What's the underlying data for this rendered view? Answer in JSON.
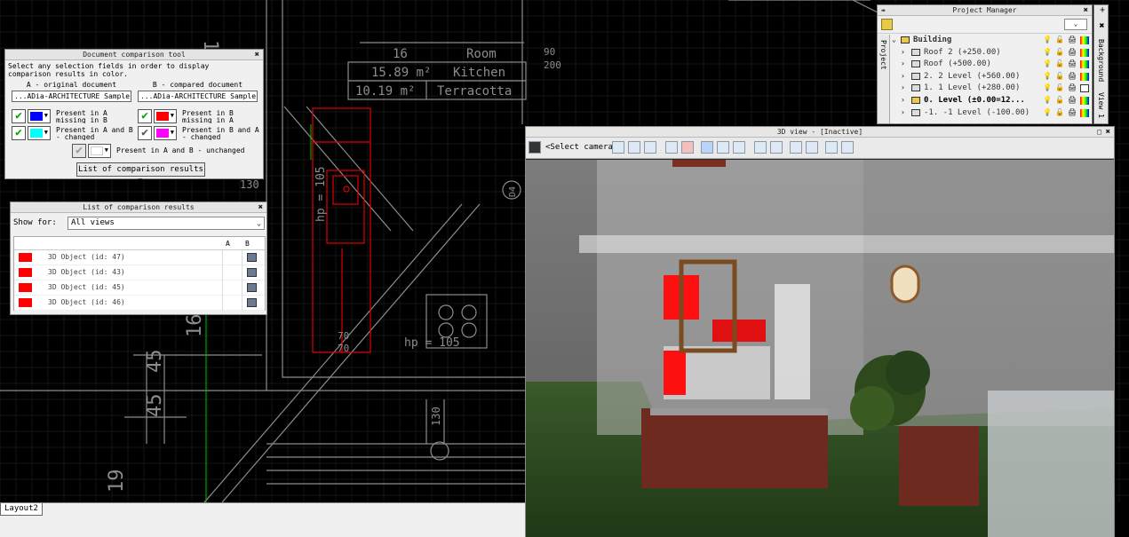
{
  "doc_tool": {
    "title": "Document comparison tool",
    "description": "Select any selection fields in order to display comparison results in color.",
    "col_a_header": "A - original document",
    "col_b_header": "B - compared document",
    "doc_a": "...ADia-ARCHITECTURE Sample 2",
    "doc_b": "...ADia-ARCHITECTURE Sample 2",
    "opt_a_missing": "Present in A missing in B",
    "opt_ab_changed": "Present in A and B - changed",
    "opt_b_missing": "Present in B missing in A",
    "opt_ba_changed": "Present in B and A - changed",
    "opt_unchanged": "Present in A and B - unchanged",
    "results_button": "List of comparison results",
    "colors": {
      "a_missing": "#0000ff",
      "ab_changed": "#00ffff",
      "b_missing": "#ff0000",
      "ba_changed": "#ff00ff",
      "unchanged": "#ffffff"
    }
  },
  "results": {
    "title": "List of comparison results",
    "show_for_label": "Show for:",
    "show_for_value": "All views",
    "col_a": "A",
    "col_b": "B",
    "rows": [
      "3D Object (id: 47)",
      "3D Object (id: 43)",
      "3D Object (id: 45)",
      "3D Object (id: 46)"
    ]
  },
  "project_manager": {
    "title": "Project Manager",
    "side_tab": "Project",
    "items": [
      "Building",
      "Roof 2 (+250.00)",
      "Roof (+500.00)",
      "2. 2 Level (+560.00)",
      "1. 1 Level (+280.00)",
      "0. Level (±0.00=12...",
      "-1. -1 Level (-100.00)"
    ]
  },
  "right_tabs": [
    "Background",
    "View 1"
  ],
  "view3d": {
    "title": "3D view - [Inactive]",
    "camera": "<Select camera>"
  },
  "cad": {
    "room_no": "16",
    "room_name": "Room",
    "area": "15.89 m²",
    "kitchen": "Kitchen",
    "area2": "10.19 m²",
    "floor": "Terracotta",
    "dim1": "90",
    "dim2": "200",
    "hp1": "hp = 105",
    "hp2": "hp = 105",
    "dim3": "70",
    "dim4": "70",
    "dim5": "130",
    "dim6": "45",
    "dim7": "45",
    "dim8": "19",
    "dim9": "16",
    "dim10": "D4",
    "dim11": "130",
    "dim12": "19"
  },
  "layout_tab": "Layout2"
}
